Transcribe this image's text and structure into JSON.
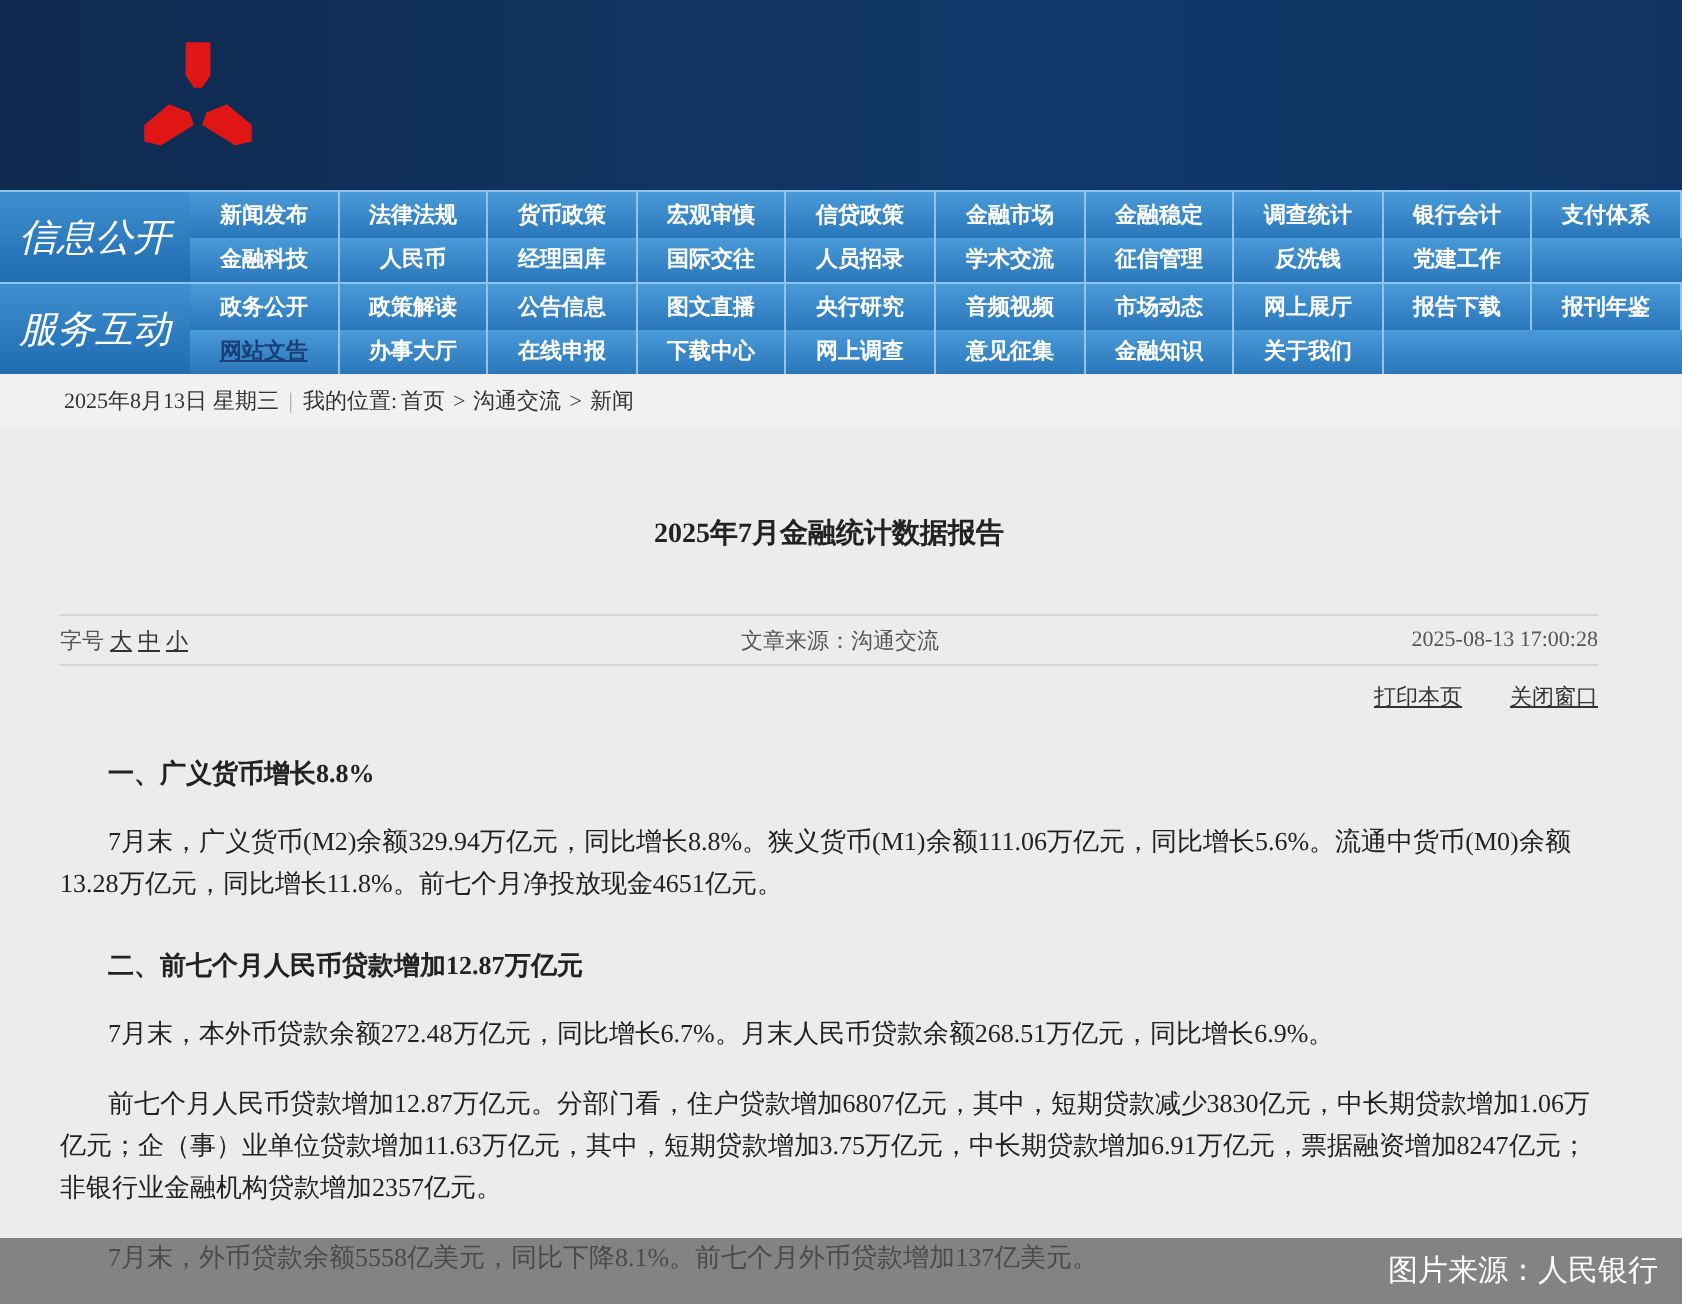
{
  "nav_groups": [
    {
      "label": "信息公开",
      "rows": [
        [
          {
            "label": "新闻发布",
            "selected": false
          },
          {
            "label": "法律法规",
            "selected": false
          },
          {
            "label": "货币政策",
            "selected": false
          },
          {
            "label": "宏观审慎",
            "selected": false
          },
          {
            "label": "信贷政策",
            "selected": false
          },
          {
            "label": "金融市场",
            "selected": false
          },
          {
            "label": "金融稳定",
            "selected": false
          },
          {
            "label": "调查统计",
            "selected": false
          },
          {
            "label": "银行会计",
            "selected": false
          },
          {
            "label": "支付体系",
            "selected": false
          }
        ],
        [
          {
            "label": "金融科技",
            "selected": false
          },
          {
            "label": "人民币",
            "selected": false
          },
          {
            "label": "经理国库",
            "selected": false
          },
          {
            "label": "国际交往",
            "selected": false
          },
          {
            "label": "人员招录",
            "selected": false
          },
          {
            "label": "学术交流",
            "selected": false
          },
          {
            "label": "征信管理",
            "selected": false
          },
          {
            "label": "反洗钱",
            "selected": false
          },
          {
            "label": "党建工作",
            "selected": false
          }
        ]
      ]
    },
    {
      "label": "服务互动",
      "rows": [
        [
          {
            "label": "政务公开",
            "selected": false
          },
          {
            "label": "政策解读",
            "selected": false
          },
          {
            "label": "公告信息",
            "selected": false
          },
          {
            "label": "图文直播",
            "selected": false
          },
          {
            "label": "央行研究",
            "selected": false
          },
          {
            "label": "音频视频",
            "selected": false
          },
          {
            "label": "市场动态",
            "selected": false
          },
          {
            "label": "网上展厅",
            "selected": false
          },
          {
            "label": "报告下载",
            "selected": false
          },
          {
            "label": "报刊年鉴",
            "selected": false
          }
        ],
        [
          {
            "label": "网站文告",
            "selected": true
          },
          {
            "label": "办事大厅",
            "selected": false
          },
          {
            "label": "在线申报",
            "selected": false
          },
          {
            "label": "下载中心",
            "selected": false
          },
          {
            "label": "网上调查",
            "selected": false
          },
          {
            "label": "意见征集",
            "selected": false
          },
          {
            "label": "金融知识",
            "selected": false
          },
          {
            "label": "关于我们",
            "selected": false
          }
        ]
      ]
    }
  ],
  "breadcrumb": {
    "date": "2025年8月13日 星期三",
    "separator": "|",
    "prefix": "我的位置:",
    "items": [
      "首页",
      "沟通交流",
      "新闻"
    ],
    "arrow": ">"
  },
  "article": {
    "title": "2025年7月金融统计数据报告",
    "font_size_label": "字号",
    "font_sizes": [
      "大",
      "中",
      "小"
    ],
    "source": "文章来源：沟通交流",
    "timestamp": "2025-08-13 17:00:28",
    "actions": [
      "打印本页",
      "关闭窗口"
    ],
    "blocks": [
      {
        "kind": "heading",
        "text": "一、广义货币增长8.8%"
      },
      {
        "kind": "paragraph",
        "text": "7月末，广义货币(M2)余额329.94万亿元，同比增长8.8%。狭义货币(M1)余额111.06万亿元，同比增长5.6%。流通中货币(M0)余额13.28万亿元，同比增长11.8%。前七个月净投放现金4651亿元。"
      },
      {
        "kind": "heading",
        "text": "二、前七个月人民币贷款增加12.87万亿元"
      },
      {
        "kind": "paragraph",
        "text": "7月末，本外币贷款余额272.48万亿元，同比增长6.7%。月末人民币贷款余额268.51万亿元，同比增长6.9%。"
      },
      {
        "kind": "paragraph",
        "text": "前七个月人民币贷款增加12.87万亿元。分部门看，住户贷款增加6807亿元，其中，短期贷款减少3830亿元，中长期贷款增加1.06万亿元；企（事）业单位贷款增加11.63万亿元，其中，短期贷款增加3.75万亿元，中长期贷款增加6.91万亿元，票据融资增加8247亿元；非银行业金融机构贷款增加2357亿元。"
      },
      {
        "kind": "paragraph",
        "text": "7月末，外币贷款余额5558亿美元，同比下降8.1%。前七个月外币贷款增加137亿美元。"
      }
    ]
  },
  "caption": "图片来源：人民银行"
}
